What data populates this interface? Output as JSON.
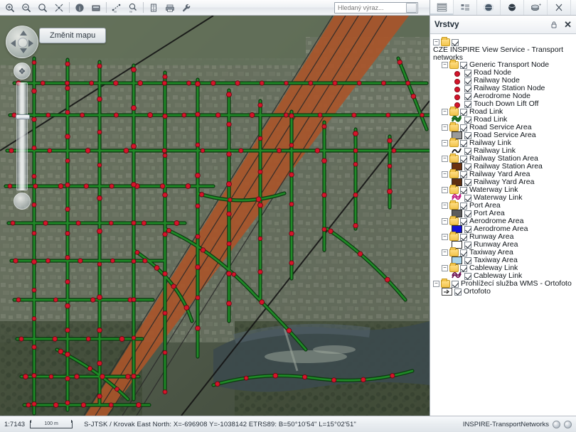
{
  "toolbar": {
    "buttons": [
      {
        "name": "zoom-in-icon",
        "title": "Zoom in"
      },
      {
        "name": "zoom-out-icon",
        "title": "Zoom out"
      },
      {
        "name": "zoom-full-extent-icon",
        "title": "Full extent"
      },
      {
        "name": "pan-icon",
        "title": "Pan"
      },
      {
        "name": "identify-info-icon",
        "title": "Identify"
      },
      {
        "name": "select-rectangle-icon",
        "title": "Select"
      },
      {
        "name": "measure-distance-icon",
        "title": "Measure distance"
      },
      {
        "name": "measure-area-icon",
        "title": "Measure area"
      },
      {
        "name": "legend-icon",
        "title": "Legend"
      },
      {
        "name": "print-icon",
        "title": "Print"
      },
      {
        "name": "tools-wrench-icon",
        "title": "Tools"
      }
    ],
    "search_placeholder": "Hledaný výraz..."
  },
  "map": {
    "change_map_label": "Změnit mapu",
    "nav_pad_name": "pan-direction-pad",
    "zoom_slider_name": "zoom-slider"
  },
  "panel": {
    "tabs": [
      {
        "name": "tab-layers",
        "icon": "layers-icon",
        "active": true
      },
      {
        "name": "tab-legend",
        "icon": "legend-list-icon",
        "active": false
      },
      {
        "name": "tab-globe-blue",
        "icon": "globe-icon",
        "active": false
      },
      {
        "name": "tab-globe-dark",
        "icon": "globe-dark-icon",
        "active": false
      },
      {
        "name": "tab-add-layer",
        "icon": "add-layer-icon",
        "active": false
      },
      {
        "name": "tab-measure",
        "icon": "scissors-icon",
        "active": false
      }
    ],
    "title": "Vrstvy",
    "pin_icon": "pin-icon",
    "close_icon": "close-icon"
  },
  "layers": [
    {
      "label": "CZE INSPIRE View Service - Transport networks",
      "level": 0,
      "type": "folder",
      "checked": true,
      "expanded": true
    },
    {
      "label": "Generic Transport Node",
      "level": 1,
      "type": "folder",
      "checked": true,
      "expanded": true
    },
    {
      "label": "Road Node",
      "level": 2,
      "type": "symbol",
      "checked": true,
      "symbol": "dot",
      "color": "#d5142a"
    },
    {
      "label": "Railway Node",
      "level": 2,
      "type": "symbol",
      "checked": true,
      "symbol": "dot",
      "color": "#d5142a"
    },
    {
      "label": "Railway Station Node",
      "level": 2,
      "type": "symbol",
      "checked": true,
      "symbol": "dot",
      "color": "#d5142a"
    },
    {
      "label": "Aerodrome Node",
      "level": 2,
      "type": "symbol",
      "checked": true,
      "symbol": "dot",
      "color": "#d5142a"
    },
    {
      "label": "Touch Down Lift Off",
      "level": 2,
      "type": "symbol",
      "checked": true,
      "symbol": "dot",
      "color": "#d5142a"
    },
    {
      "label": "Road Link",
      "level": 1,
      "type": "folder",
      "checked": true,
      "expanded": true
    },
    {
      "label": "Road Link",
      "level": 2,
      "type": "symbol",
      "checked": true,
      "symbol": "line-green",
      "color": "#1d6b22"
    },
    {
      "label": "Road Service Area",
      "level": 1,
      "type": "folder",
      "checked": true,
      "expanded": true
    },
    {
      "label": "Road Service Area",
      "level": 2,
      "type": "symbol",
      "checked": true,
      "symbol": "box",
      "color": "#9a9a9a"
    },
    {
      "label": "Railway Link",
      "level": 1,
      "type": "folder",
      "checked": true,
      "expanded": true
    },
    {
      "label": "Railway Link",
      "level": 2,
      "type": "symbol",
      "checked": true,
      "symbol": "line-black",
      "color": "#111111"
    },
    {
      "label": "Railway Station Area",
      "level": 1,
      "type": "folder",
      "checked": true,
      "expanded": true
    },
    {
      "label": "Railway Station Area",
      "level": 2,
      "type": "symbol",
      "checked": true,
      "symbol": "box",
      "color": "#6b3310"
    },
    {
      "label": "Railway Yard Area",
      "level": 1,
      "type": "folder",
      "checked": true,
      "expanded": true
    },
    {
      "label": "Railway Yard Area",
      "level": 2,
      "type": "symbol",
      "checked": true,
      "symbol": "box",
      "color": "#5e2f12"
    },
    {
      "label": "Waterway Link",
      "level": 1,
      "type": "folder",
      "checked": true,
      "expanded": true
    },
    {
      "label": "Waterway Link",
      "level": 2,
      "type": "symbol",
      "checked": true,
      "symbol": "line-magenta",
      "color": "#c0187f"
    },
    {
      "label": "Port Area",
      "level": 1,
      "type": "folder",
      "checked": true,
      "expanded": true
    },
    {
      "label": "Port Area",
      "level": 2,
      "type": "symbol",
      "checked": true,
      "symbol": "box",
      "color": "#5c5c5c"
    },
    {
      "label": "Aerodrome Area",
      "level": 1,
      "type": "folder",
      "checked": true,
      "expanded": true
    },
    {
      "label": "Aerodrome Area",
      "level": 2,
      "type": "symbol",
      "checked": true,
      "symbol": "box",
      "color": "#1212d8"
    },
    {
      "label": "Runway Area",
      "level": 1,
      "type": "folder",
      "checked": true,
      "expanded": true
    },
    {
      "label": "Runway Area",
      "level": 2,
      "type": "symbol",
      "checked": true,
      "symbol": "box",
      "color": "#ffffff"
    },
    {
      "label": "Taxiway Area",
      "level": 1,
      "type": "folder",
      "checked": true,
      "expanded": true
    },
    {
      "label": "Taxiway Area",
      "level": 2,
      "type": "symbol",
      "checked": true,
      "symbol": "box",
      "color": "#aad4ea"
    },
    {
      "label": "Cableway Link",
      "level": 1,
      "type": "folder",
      "checked": true,
      "expanded": true
    },
    {
      "label": "Cableway Link",
      "level": 2,
      "type": "symbol",
      "checked": true,
      "symbol": "line-purple",
      "color": "#6b1050"
    },
    {
      "label": "Prohlížecí služba WMS - Ortofoto",
      "level": 0,
      "type": "folder",
      "checked": true,
      "expanded": true
    },
    {
      "label": "Ortofoto",
      "level": 1,
      "type": "symbol",
      "checked": true,
      "symbol": "wms",
      "color": "#ffffff"
    }
  ],
  "status": {
    "scale": "1:7143",
    "scalebar_label": "100 m",
    "coordinates": "S-JTSK / Krovak East North: X=-696908 Y=-1038142   ETRS89: B=50°10'54\" L=15°02'51\"",
    "project_name": "INSPIRE-TransportNetworks"
  }
}
